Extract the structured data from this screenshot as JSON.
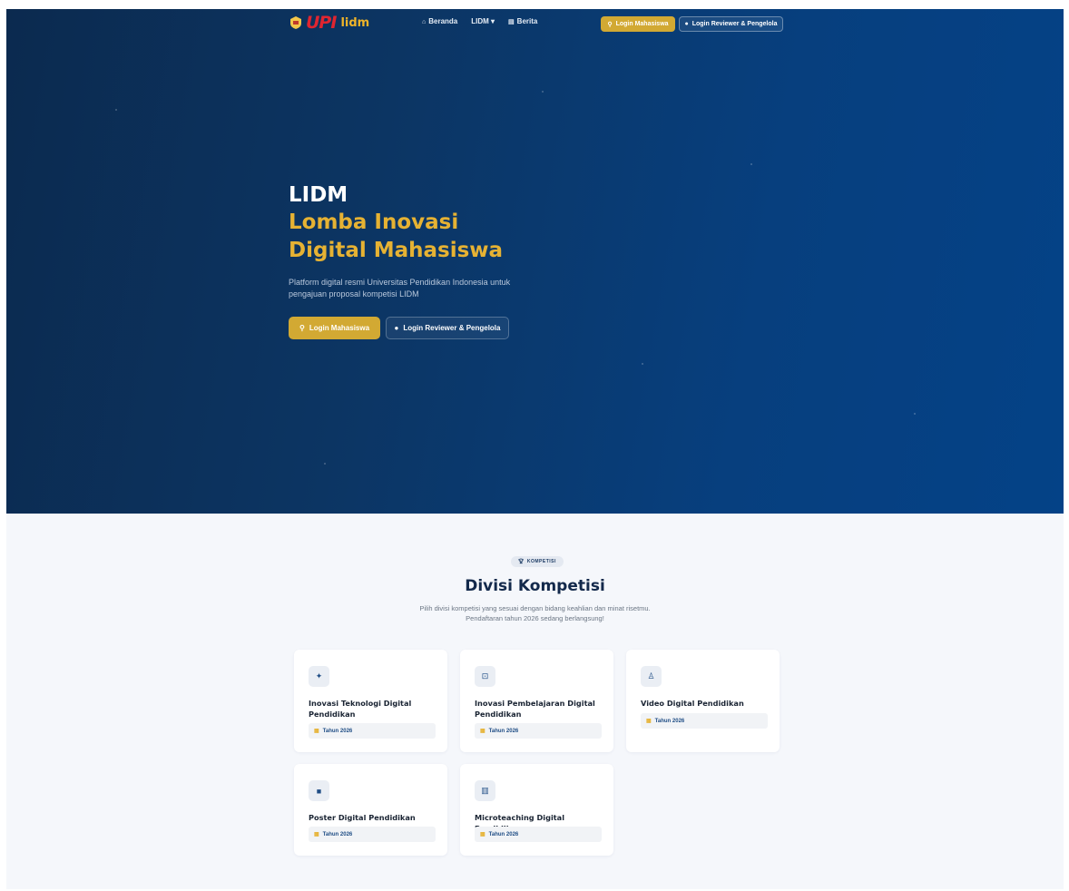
{
  "nav": {
    "logo_upi": "UPI",
    "logo_lidm": "lidm",
    "links": [
      {
        "icon": "home-icon",
        "label": "Beranda"
      },
      {
        "icon": "",
        "label": "LIDM ▾"
      },
      {
        "icon": "news-icon",
        "label": "Berita"
      }
    ],
    "login_student": "Login Mahasiswa",
    "login_reviewer": "Login Reviewer & Pengelola"
  },
  "hero": {
    "line1": "LIDM",
    "line2": "Lomba Inovasi",
    "line3": "Digital Mahasiswa",
    "description": "Platform digital resmi Universitas Pendidikan Indonesia untuk pengajuan proposal kompetisi LIDM",
    "login_student": "Login Mahasiswa",
    "login_reviewer": "Login Reviewer & Pengelola"
  },
  "section": {
    "badge": "KOMPETISI",
    "title": "Divisi Kompetisi",
    "description": "Pilih divisi kompetisi yang sesuai dengan bidang keahlian dan minat risetmu. Pendaftaran tahun 2026 sedang berlangsung!"
  },
  "divisions": [
    {
      "icon": "lightbulb-icon",
      "title": "Inovasi Teknologi Digital Pendidikan",
      "year": "Tahun 2026"
    },
    {
      "icon": "code-icon",
      "title": "Inovasi Pembelajaran Digital Pendidikan",
      "year": "Tahun 2026"
    },
    {
      "icon": "teacher-icon",
      "title": "Video Digital Pendidikan",
      "year": "Tahun 2026"
    },
    {
      "icon": "book-icon",
      "title": "Poster Digital Pendidikan",
      "year": "Tahun 2026"
    },
    {
      "icon": "chart-icon",
      "title": "Microteaching Digital Pendidikan",
      "year": "Tahun 2026"
    }
  ],
  "colors": {
    "hero_bg": "#0c3563",
    "accent_gold": "#d2a933",
    "title_gold": "#e6b233",
    "brand_red": "#e02530",
    "navy": "#13294b"
  }
}
